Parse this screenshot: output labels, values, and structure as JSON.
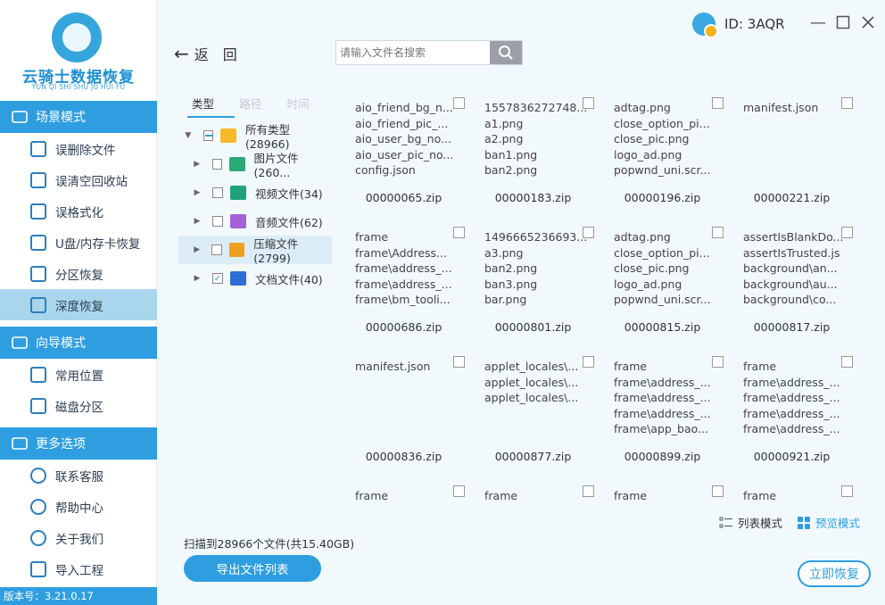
{
  "app": {
    "logo_title": "云骑士数据恢复",
    "logo_subtitle": "YUN QI SHI SHU JU HUI FU",
    "version": "版本号：3.21.0.17"
  },
  "colors": {
    "accent": "#2e9ee0",
    "active_item": "#a9d6ec"
  },
  "sidebar": {
    "sections": [
      {
        "label": "场景模式",
        "icon": "monitor-icon",
        "items": [
          {
            "label": "误删除文件",
            "icon": "file-delete-icon",
            "active": false
          },
          {
            "label": "误清空回收站",
            "icon": "recycle-bin-icon",
            "active": false
          },
          {
            "label": "误格式化",
            "icon": "format-disk-icon",
            "active": false
          },
          {
            "label": "U盘/内存卡恢复",
            "icon": "usb-icon",
            "active": false
          },
          {
            "label": "分区恢复",
            "icon": "partition-icon",
            "active": false
          },
          {
            "label": "深度恢复",
            "icon": "deep-recovery-icon",
            "active": true
          }
        ]
      },
      {
        "label": "向导模式",
        "icon": "signpost-icon",
        "items": [
          {
            "label": "常用位置",
            "icon": "windows-icon",
            "active": false
          },
          {
            "label": "磁盘分区",
            "icon": "disk-icon",
            "active": false
          }
        ]
      },
      {
        "label": "更多选项",
        "icon": "menu-icon",
        "items": [
          {
            "label": "联系客服",
            "icon": "phone-icon",
            "active": false
          },
          {
            "label": "帮助中心",
            "icon": "help-icon",
            "active": false
          },
          {
            "label": "关于我们",
            "icon": "info-icon",
            "active": false
          },
          {
            "label": "导入工程",
            "icon": "import-icon",
            "active": false
          }
        ]
      }
    ]
  },
  "header": {
    "user_id": "ID: 3AQR",
    "back_label": "返　回",
    "search_placeholder": "请输入文件名搜索"
  },
  "tree": {
    "tabs": [
      "类型",
      "路径",
      "时间"
    ],
    "rows": [
      {
        "label": "所有类型(28966)",
        "icon": "folder-icon",
        "color": "#f7b928",
        "expanded": true,
        "check": "partial",
        "level": 0
      },
      {
        "label": "图片文件(260...",
        "icon": "image-icon",
        "color": "#2aa876",
        "expanded": false,
        "check": "none",
        "level": 1
      },
      {
        "label": "视频文件(34)",
        "icon": "video-icon",
        "color": "#1fa37b",
        "expanded": false,
        "check": "none",
        "level": 1
      },
      {
        "label": "音频文件(62)",
        "icon": "audio-icon",
        "color": "#a560d8",
        "expanded": false,
        "check": "none",
        "level": 1
      },
      {
        "label": "压缩文件(2799)",
        "icon": "archive-icon",
        "color": "#f0a020",
        "expanded": false,
        "check": "none",
        "level": 1,
        "highlight": true
      },
      {
        "label": "文档文件(40)",
        "icon": "document-icon",
        "color": "#2b6fd6",
        "expanded": false,
        "check": "checked",
        "level": 1
      }
    ]
  },
  "grid": {
    "cards": [
      {
        "name": "00000065.zip",
        "lines": [
          "aio_friend_bg_n...",
          "aio_friend_pic_...",
          "aio_user_bg_no...",
          "aio_user_pic_no...",
          "config.json"
        ]
      },
      {
        "name": "00000183.zip",
        "lines": [
          "1557836272748...",
          "a1.png",
          "a2.png",
          "ban1.png",
          "ban2.png"
        ]
      },
      {
        "name": "00000196.zip",
        "lines": [
          "adtag.png",
          "close_option_pi...",
          "close_pic.png",
          "logo_ad.png",
          "popwnd_uni.scr..."
        ]
      },
      {
        "name": "00000221.zip",
        "lines": [
          "manifest.json"
        ]
      },
      {
        "name": "00000686.zip",
        "lines": [
          "frame",
          "frame\\Address...",
          "frame\\address_...",
          "frame\\address_...",
          "frame\\bm_tooli..."
        ]
      },
      {
        "name": "00000801.zip",
        "lines": [
          "1496665236693...",
          "a3.png",
          "ban2.png",
          "ban3.png",
          "bar.png"
        ]
      },
      {
        "name": "00000815.zip",
        "lines": [
          "adtag.png",
          "close_option_pi...",
          "close_pic.png",
          "logo_ad.png",
          "popwnd_uni.scr..."
        ]
      },
      {
        "name": "00000817.zip",
        "lines": [
          "assertIsBlankDo...",
          "assertIsTrusted.js",
          "background\\an...",
          "background\\au...",
          "background\\co..."
        ]
      },
      {
        "name": "00000836.zip",
        "lines": [
          "manifest.json"
        ]
      },
      {
        "name": "00000877.zip",
        "lines": [
          "applet_locales\\...",
          "applet_locales\\...",
          "applet_locales\\..."
        ]
      },
      {
        "name": "00000899.zip",
        "lines": [
          "frame",
          "frame\\address_...",
          "frame\\address_...",
          "frame\\address_...",
          "frame\\app_bao..."
        ]
      },
      {
        "name": "00000921.zip",
        "lines": [
          "frame",
          "frame\\address_...",
          "frame\\address_...",
          "frame\\address_...",
          "frame\\address_..."
        ]
      },
      {
        "name": "",
        "lines": [
          "frame"
        ]
      },
      {
        "name": "",
        "lines": [
          "frame"
        ]
      },
      {
        "name": "",
        "lines": [
          "frame"
        ]
      },
      {
        "name": "",
        "lines": [
          "frame"
        ]
      }
    ]
  },
  "view": {
    "list_label": "列表模式",
    "preview_label": "预览模式",
    "active": "preview"
  },
  "footer": {
    "scan_info": "扫描到28966个文件(共15.40GB)",
    "export_label": "导出文件列表",
    "recover_label": "立即恢复"
  }
}
